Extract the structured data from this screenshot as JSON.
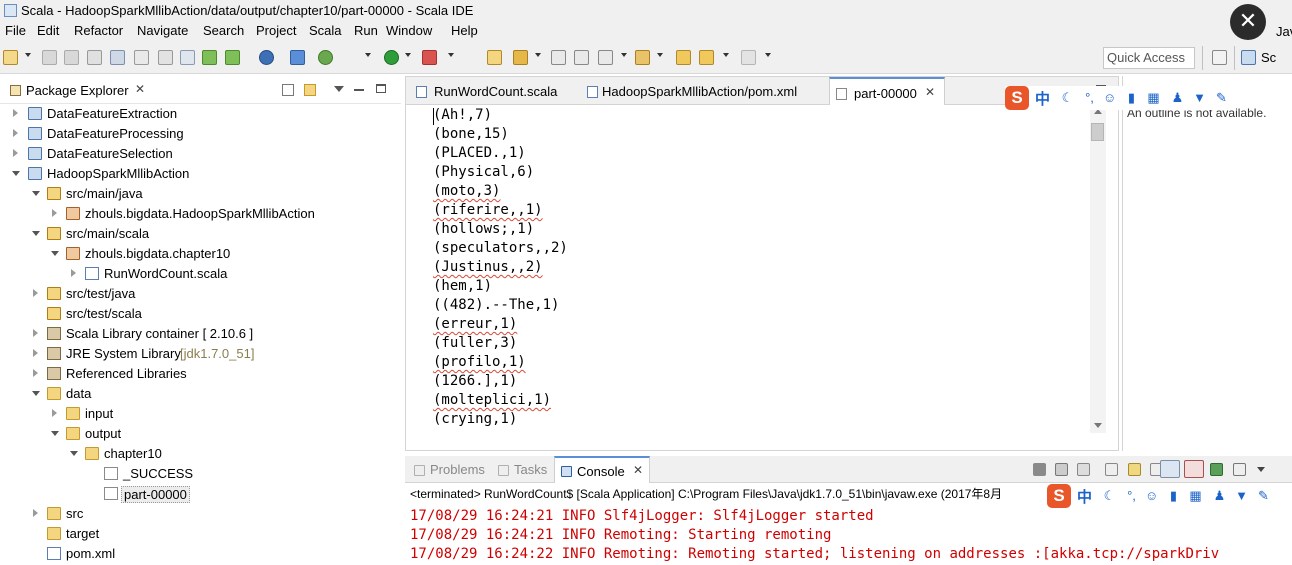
{
  "window": {
    "title": "Scala - HadoopSparkMllibAction/data/output/chapter10/part-00000 - Scala IDE",
    "close_glyph": "✕"
  },
  "menu": [
    "File",
    "Edit",
    "Refactor",
    "Navigate",
    "Search",
    "Project",
    "Scala",
    "Run",
    "Window",
    "Help"
  ],
  "toolbar": {
    "quick_access": "Quick Access",
    "perspective_labels": [
      "Java",
      "Sc"
    ]
  },
  "package_explorer": {
    "title": "Package Explorer",
    "close_glyph": "✕",
    "tree": [
      {
        "label": "DataFeatureExtraction",
        "icon": "project-icon",
        "twisty": "closed"
      },
      {
        "label": "DataFeatureProcessing",
        "icon": "project-icon",
        "twisty": "closed"
      },
      {
        "label": "DataFeatureSelection",
        "icon": "project-icon",
        "twisty": "closed"
      },
      {
        "label": "HadoopSparkMllibAction",
        "icon": "project-icon",
        "twisty": "open"
      },
      {
        "label": "src/main/java",
        "icon": "source-folder-icon",
        "twisty": "open"
      },
      {
        "label": "zhouls.bigdata.HadoopSparkMllibAction",
        "icon": "package-icon",
        "twisty": "closed"
      },
      {
        "label": "src/main/scala",
        "icon": "source-folder-icon",
        "twisty": "open"
      },
      {
        "label": "zhouls.bigdata.chapter10",
        "icon": "package-icon",
        "twisty": "open"
      },
      {
        "label": "RunWordCount.scala",
        "icon": "scala-file-icon",
        "twisty": "closed"
      },
      {
        "label": "src/test/java",
        "icon": "source-folder-icon",
        "twisty": "closed"
      },
      {
        "label": "src/test/scala",
        "icon": "source-folder-icon",
        "twisty": "none"
      },
      {
        "label": "Scala Library container [ 2.10.6 ]",
        "icon": "library-icon",
        "twisty": "closed"
      },
      {
        "label": "JRE System Library",
        "suffix": "[jdk1.7.0_51]",
        "icon": "library-icon",
        "twisty": "closed"
      },
      {
        "label": "Referenced Libraries",
        "icon": "library-icon",
        "twisty": "closed"
      },
      {
        "label": "data",
        "icon": "folder-icon",
        "twisty": "open"
      },
      {
        "label": "input",
        "icon": "folder-icon",
        "twisty": "closed"
      },
      {
        "label": "output",
        "icon": "folder-icon",
        "twisty": "open"
      },
      {
        "label": "chapter10",
        "icon": "folder-icon",
        "twisty": "open"
      },
      {
        "label": "_SUCCESS",
        "icon": "file-icon",
        "twisty": "none"
      },
      {
        "label": "part-00000",
        "icon": "file-icon",
        "twisty": "none",
        "selected": true
      },
      {
        "label": "src",
        "icon": "folder-icon",
        "twisty": "closed"
      },
      {
        "label": "target",
        "icon": "folder-icon",
        "twisty": "none"
      },
      {
        "label": "pom.xml",
        "icon": "xml-file-icon",
        "twisty": "none"
      }
    ]
  },
  "editor": {
    "tabs": [
      {
        "label": "RunWordCount.scala",
        "active": false
      },
      {
        "label": "HadoopSparkMllibAction/pom.xml",
        "active": false
      },
      {
        "label": "part-00000",
        "active": true,
        "close_glyph": "✕"
      }
    ],
    "lines": [
      "(Ah!,7)",
      "(bone,15)",
      "(PLACED.,1)",
      "(Physical,6)",
      "(moto,3)",
      "(riferire,,1)",
      "(hollows;,1)",
      "(speculators,,2)",
      "(Justinus,,2)",
      "(hem,1)",
      "((482).--The,1)",
      "(erreur,1)",
      "(fuller,3)",
      "(profilo,1)",
      "(1266.],1)",
      "(molteplici,1)",
      "(crying,1)"
    ]
  },
  "outline": {
    "message": "An outline is not available."
  },
  "ime": {
    "logo": "S",
    "zh": "中"
  },
  "console": {
    "tabs": [
      "Problems",
      "Tasks",
      "Console"
    ],
    "console_close": "✕",
    "status": "<terminated> RunWordCount$ [Scala Application] C:\\Program Files\\Java\\jdk1.7.0_51\\bin\\javaw.exe (2017年8月",
    "log": [
      "17/08/29 16:24:21 INFO Slf4jLogger: Slf4jLogger started",
      "17/08/29 16:24:21 INFO Remoting: Starting remoting",
      "17/08/29 16:24:22 INFO Remoting: Remoting started; listening on addresses :[akka.tcp://sparkDriv"
    ]
  },
  "colors": {
    "chrome_bg": "#f0f0f0",
    "active_tab_accent": "#5a8fd8",
    "console_error_text": "#d00000",
    "ime_brand": "#e8562a",
    "ime_icon": "#1c63c9"
  }
}
